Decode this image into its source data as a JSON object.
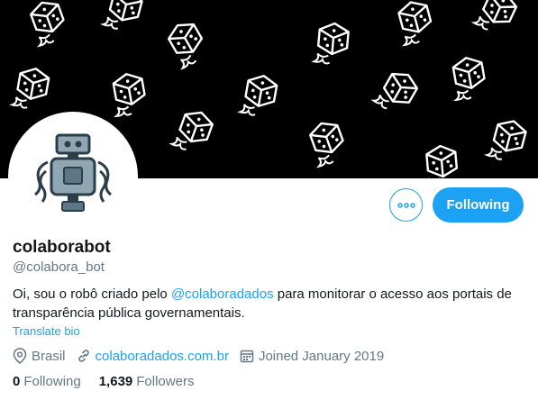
{
  "profile": {
    "display_name": "colaborabot",
    "handle": "@colabora_bot",
    "bio_prefix": "Oi, sou o robô criado pelo ",
    "bio_mention": "@colaboradados",
    "bio_suffix": " para monitorar o acesso aos portais de transparência pública governamentais.",
    "translate_label": "Translate bio",
    "location": "Brasil",
    "website": "colaboradados.com.br",
    "joined": "Joined January 2019",
    "following_count": "0",
    "following_label": "Following",
    "followers_count": "1,639",
    "followers_label": "Followers"
  },
  "actions": {
    "following_button_label": "Following"
  },
  "icons": {
    "more": "more-options-icon",
    "location": "location-pin-icon",
    "link": "link-icon",
    "calendar": "calendar-icon"
  },
  "colors": {
    "accent": "#1da1f2",
    "text": "#14171a",
    "muted": "#657786",
    "banner": "#000000"
  }
}
